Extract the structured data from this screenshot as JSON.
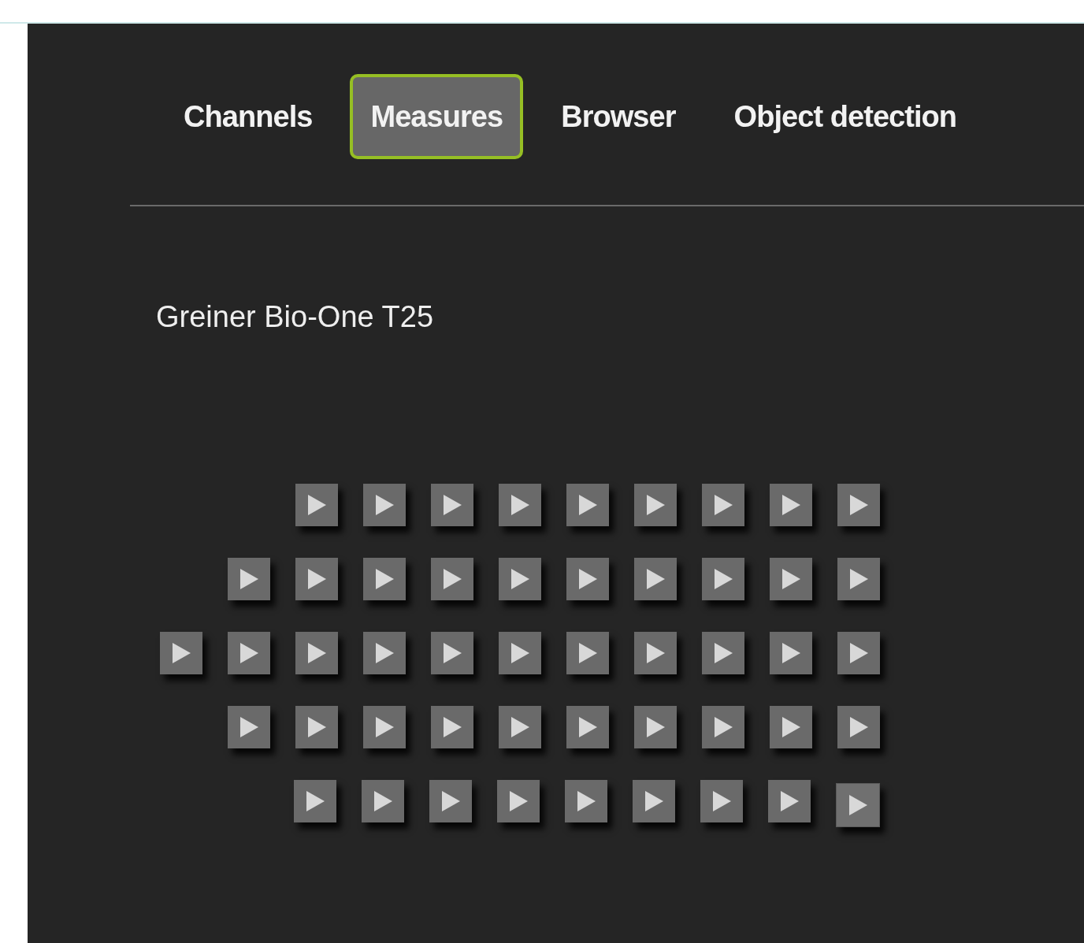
{
  "tabs": [
    {
      "label": "Channels",
      "selected": false
    },
    {
      "label": "Measures",
      "selected": true
    },
    {
      "label": "Browser",
      "selected": false
    },
    {
      "label": "Object detection",
      "selected": false
    }
  ],
  "plate": {
    "title": "Greiner Bio-One T25",
    "rows": [
      [
        {
          "hovered": false
        },
        {
          "hovered": false
        },
        {
          "hovered": false
        },
        {
          "hovered": false
        },
        {
          "hovered": false
        },
        {
          "hovered": false
        },
        {
          "hovered": false
        },
        {
          "hovered": false
        },
        {
          "hovered": false
        }
      ],
      [
        {
          "hovered": false
        },
        {
          "hovered": false
        },
        {
          "hovered": false
        },
        {
          "hovered": false
        },
        {
          "hovered": false
        },
        {
          "hovered": false
        },
        {
          "hovered": false
        },
        {
          "hovered": false
        },
        {
          "hovered": false
        },
        {
          "hovered": false
        }
      ],
      [
        {
          "hovered": false
        },
        {
          "hovered": false
        },
        {
          "hovered": false
        },
        {
          "hovered": false
        },
        {
          "hovered": false
        },
        {
          "hovered": false
        },
        {
          "hovered": false
        },
        {
          "hovered": false
        },
        {
          "hovered": false
        },
        {
          "hovered": false
        },
        {
          "hovered": false
        }
      ],
      [
        {
          "hovered": false
        },
        {
          "hovered": false
        },
        {
          "hovered": false
        },
        {
          "hovered": false
        },
        {
          "hovered": false
        },
        {
          "hovered": false
        },
        {
          "hovered": false
        },
        {
          "hovered": false
        },
        {
          "hovered": false
        },
        {
          "hovered": false
        }
      ],
      [
        {
          "hovered": false
        },
        {
          "hovered": false
        },
        {
          "hovered": false
        },
        {
          "hovered": false
        },
        {
          "hovered": false
        },
        {
          "hovered": false
        },
        {
          "hovered": false
        },
        {
          "hovered": false
        },
        {
          "hovered": true
        }
      ]
    ]
  }
}
